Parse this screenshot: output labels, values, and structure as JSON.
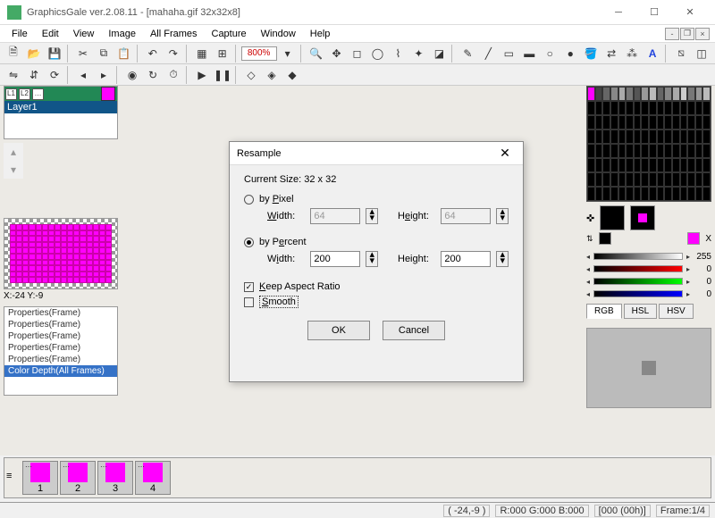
{
  "title": "GraphicsGale ver.2.08.11 - [mahaha.gif 32x32x8]",
  "menu": [
    "File",
    "Edit",
    "View",
    "Image",
    "All Frames",
    "Capture",
    "Window",
    "Help"
  ],
  "zoom": "800%",
  "layer": {
    "name": "Layer1",
    "cells": [
      "L1",
      "L2",
      "…"
    ]
  },
  "coord": "X:-24 Y:-9",
  "history": [
    "Properties(Frame)",
    "Properties(Frame)",
    "Properties(Frame)",
    "Properties(Frame)",
    "Properties(Frame)",
    "Color Depth(All Frames)"
  ],
  "history_selected": 5,
  "frames": [
    1,
    2,
    3,
    4
  ],
  "slider_max_label": "255",
  "slider_values": [
    "0",
    "0",
    "0"
  ],
  "color_tabs": [
    "RGB",
    "HSL",
    "HSV"
  ],
  "color_tab_active": 0,
  "status": {
    "pos": "( -24,-9 )",
    "rgb": "R:000 G:000 B:000",
    "time": "[000 (00h)]",
    "frame": "Frame:1/4"
  },
  "dialog": {
    "title": "Resample",
    "current": "Current Size: 32 x 32",
    "by_pixel_label": "by Pixel",
    "by_percent_label": "by Percent",
    "mode": "percent",
    "width_label": "Width:",
    "height_label": "Height:",
    "px": {
      "w": "64",
      "h": "64"
    },
    "pct": {
      "w": "200",
      "h": "200"
    },
    "keep_aspect": true,
    "keep_aspect_label": "Keep Aspect Ratio",
    "smooth": false,
    "smooth_label": "Smooth",
    "ok": "OK",
    "cancel": "Cancel"
  }
}
